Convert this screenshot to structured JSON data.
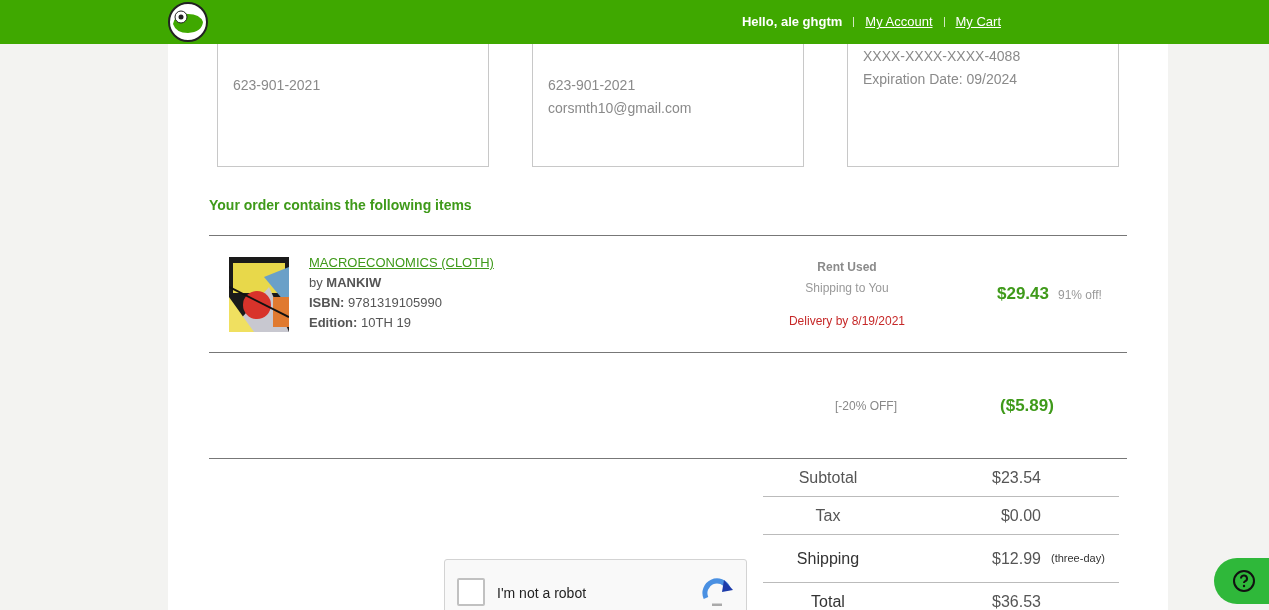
{
  "header": {
    "greeting": "Hello, ale ghgtm",
    "links": [
      "My Account",
      "My Cart"
    ]
  },
  "info_boxes": [
    {
      "lines": [
        "623-901-2021"
      ]
    },
    {
      "lines": [
        "623-901-2021",
        "corsmth10@gmail.com"
      ]
    },
    {
      "lines": [
        "XXXX-XXXX-XXXX-4088",
        "Expiration Date: 09/2024"
      ]
    }
  ],
  "order_heading": "Your order contains the following items",
  "items": [
    {
      "title": "MACROECONOMICS (CLOTH)",
      "author_label": "by",
      "author": "MANKIW",
      "isbn_label": "ISBN:",
      "isbn": "9781319105990",
      "edition_label": "Edition:",
      "edition": "10TH 19",
      "type": "Rent Used",
      "shipping": "Shipping to You",
      "delivery": "Delivery by 8/19/2021",
      "price": "$29.43",
      "discount": "91% off!"
    }
  ],
  "coupon": {
    "label": "[-20% OFF]",
    "amount": "($5.89)"
  },
  "summary": [
    {
      "label": "Subtotal",
      "value": "$23.54"
    },
    {
      "label": "Tax",
      "value": "$0.00"
    },
    {
      "label": "Shipping",
      "value": "$12.99",
      "note": "(three-day)"
    },
    {
      "label": "Total",
      "value": "$36.53"
    }
  ],
  "captcha": {
    "label": "I'm not a robot",
    "checked": false
  }
}
